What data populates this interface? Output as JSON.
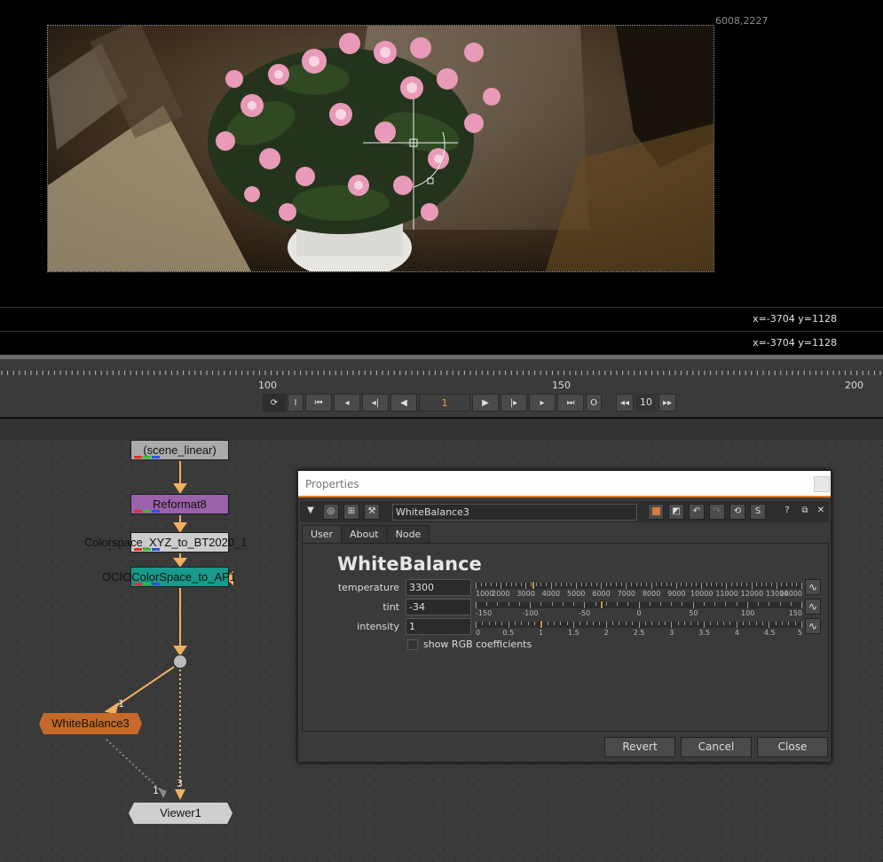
{
  "viewer": {
    "format_label": "6008,2227",
    "info_top": "x=-3704 y=1128",
    "info_bottom": "x=-3704 y=1128"
  },
  "timeline": {
    "ticks": [
      "100",
      "150",
      "200"
    ],
    "frame": "1",
    "increment": "10",
    "buttons": {
      "sync": "⟳",
      "in_point": "I",
      "first": "⏮",
      "prev_key": "◂",
      "prev_frame": "◂|",
      "play_back": "◀",
      "play_fwd": "▶",
      "next_frame": "|▸",
      "next_key": "▸",
      "last": "⏭",
      "out_point": "O",
      "step_back": "◂◂",
      "step_fwd": "▸▸"
    }
  },
  "nodegraph": {
    "nodes": {
      "read": "(scene_linear)",
      "reformat": "Reformat8",
      "colorspace": "Colorspace_XYZ_to_BT2020_1",
      "ocio": "OCIOColorSpace_to_AP1",
      "whitebalance": "WhiteBalance3",
      "viewer": "Viewer1"
    },
    "edge_labels": {
      "wb_input": "1",
      "viewer_input1": "1",
      "viewer_input3": "3"
    }
  },
  "properties": {
    "title": "Properties",
    "node_name": "WhiteBalance3",
    "tabs": [
      "User",
      "About",
      "Node"
    ],
    "heading": "WhiteBalance",
    "knobs": [
      {
        "label": "temperature",
        "value": "3300",
        "range": [
          1000,
          14000
        ],
        "tick_labels": [
          "1000",
          "2000",
          "3000",
          "4000",
          "5000",
          "6000",
          "7000",
          "8000",
          "9000",
          "10000",
          "11000",
          "12000",
          "13000",
          "14000"
        ]
      },
      {
        "label": "tint",
        "value": "-34",
        "range": [
          -150,
          150
        ],
        "tick_labels": [
          "-150",
          "-100",
          "-50",
          "0",
          "50",
          "100",
          "150"
        ]
      },
      {
        "label": "intensity",
        "value": "1",
        "range": [
          0,
          5
        ],
        "tick_labels": [
          "0",
          "0.5",
          "1",
          "1.5",
          "2",
          "2.5",
          "3",
          "3.5",
          "4",
          "4.5",
          "5"
        ]
      }
    ],
    "checkbox_label": "show RGB coefficients",
    "buttons": {
      "revert": "Revert",
      "cancel": "Cancel",
      "close": "Close"
    },
    "toolbar_icons": {
      "collapse": "▼",
      "help": "?",
      "float": "⧉",
      "close": "✕",
      "s_btn": "S"
    },
    "accent_color": "#e07d28",
    "node_color": "#d67b3c"
  }
}
